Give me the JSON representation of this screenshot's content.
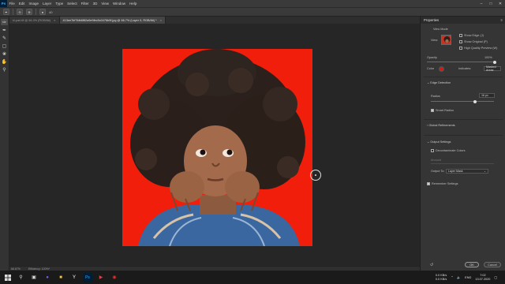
{
  "menubar": {
    "logo": "Ps",
    "items": [
      "File",
      "Edit",
      "Image",
      "Layer",
      "Type",
      "Select",
      "Filter",
      "3D",
      "View",
      "Window",
      "Help"
    ]
  },
  "options": {
    "brush_size": "40"
  },
  "tabs": [
    {
      "label": "kl-pari.tif @ 66.4% (RGB/8#)",
      "active": false
    },
    {
      "label": "413ee7bf7fdb6f82a9e9fec5c0476b9f.jpg @ 66.7% (Layer 0, RGB/8#) *",
      "active": true
    }
  ],
  "status": {
    "zoom": "66.67%",
    "info": "Efficiency: 100%*"
  },
  "properties": {
    "title": "Properties",
    "view_mode_label": "View Mode",
    "view_label": "View:",
    "show_edge": "Show Edge (J)",
    "show_original": "Show Original (P)",
    "high_quality_preview": "High Quality Preview (W)",
    "opacity_label": "Opacity",
    "opacity_value": "100%",
    "color_label": "Color",
    "indicates_label": "Indicates:",
    "indicates_value": "Masked Areas",
    "edge_detection": "Edge Detection",
    "radius_label": "Radius",
    "radius_value": "16 px",
    "smart_radius": "Smart Radius",
    "global_refinements": "Global Refinements",
    "output_settings": "Output Settings",
    "decontaminate": "Decontaminate Colors",
    "amount_label": "Amount",
    "output_to_label": "Output To:",
    "output_to_value": "Layer Mask",
    "remember_settings": "Remember Settings",
    "ok": "OK",
    "cancel": "Cancel",
    "colors": {
      "overlay": "#d11d0e"
    }
  },
  "taskbar": {
    "net_up": "0.0 KB/s",
    "net_down": "0.0 KB/s",
    "lang": "ENG",
    "time": "7:02",
    "date": "13.07.2020"
  }
}
